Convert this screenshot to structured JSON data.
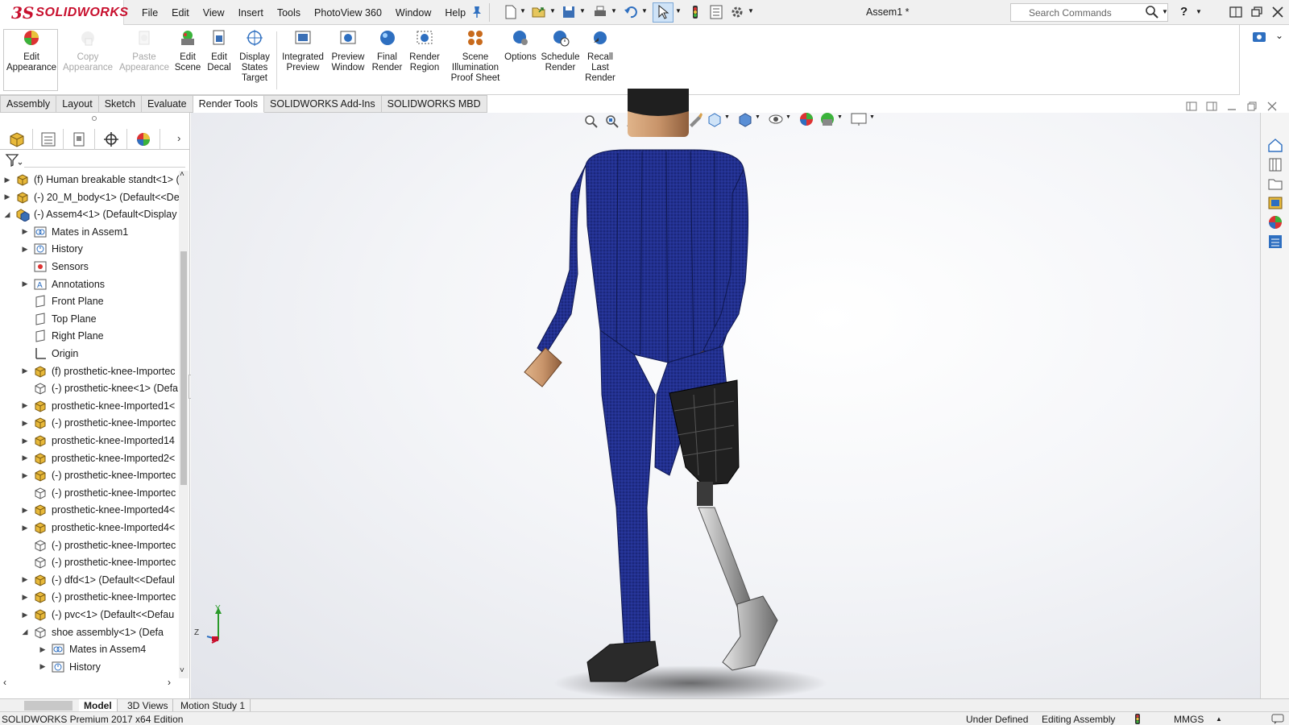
{
  "app": {
    "logo_ds": "3S",
    "logo_text": "SOLIDWORKS",
    "document_title": "Assem1 *",
    "search_placeholder": "Search Commands"
  },
  "menu": [
    "File",
    "Edit",
    "View",
    "Insert",
    "Tools",
    "PhotoView 360",
    "Window",
    "Help"
  ],
  "commands": [
    {
      "label": "Edit Appearance",
      "lines": [
        "Edit",
        "Appearance"
      ],
      "enabled": true,
      "icon": "edit-appearance-icon"
    },
    {
      "label": "Copy Appearance",
      "lines": [
        "Copy",
        "Appearance"
      ],
      "enabled": false,
      "icon": "copy-appearance-icon"
    },
    {
      "label": "Paste Appearance",
      "lines": [
        "Paste",
        "Appearance"
      ],
      "enabled": false,
      "icon": "paste-appearance-icon"
    },
    {
      "label": "Edit Scene",
      "lines": [
        "Edit",
        "Scene"
      ],
      "enabled": true,
      "icon": "edit-scene-icon"
    },
    {
      "label": "Edit Decal",
      "lines": [
        "Edit",
        "Decal"
      ],
      "enabled": true,
      "icon": "edit-decal-icon"
    },
    {
      "label": "Display States Target",
      "lines": [
        "Display",
        "States",
        "Target"
      ],
      "enabled": true,
      "icon": "display-states-icon"
    },
    {
      "label": "Integrated Preview",
      "lines": [
        "Integrated",
        "Preview"
      ],
      "enabled": true,
      "icon": "integrated-preview-icon"
    },
    {
      "label": "Preview Window",
      "lines": [
        "Preview",
        "Window"
      ],
      "enabled": true,
      "icon": "preview-window-icon"
    },
    {
      "label": "Final Render",
      "lines": [
        "Final",
        "Render"
      ],
      "enabled": true,
      "icon": "final-render-icon"
    },
    {
      "label": "Render Region",
      "lines": [
        "Render",
        "Region"
      ],
      "enabled": true,
      "icon": "render-region-icon"
    },
    {
      "label": "Scene Illumination Proof Sheet",
      "lines": [
        "Scene",
        "Illumination",
        "Proof Sheet"
      ],
      "enabled": true,
      "icon": "scene-illumination-icon"
    },
    {
      "label": "Options",
      "lines": [
        "Options"
      ],
      "enabled": true,
      "icon": "options-icon"
    },
    {
      "label": "Schedule Render",
      "lines": [
        "Schedule",
        "Render"
      ],
      "enabled": true,
      "icon": "schedule-render-icon"
    },
    {
      "label": "Recall Last Render",
      "lines": [
        "Recall",
        "Last",
        "Render"
      ],
      "enabled": true,
      "icon": "recall-render-icon"
    }
  ],
  "tabs": [
    "Assembly",
    "Layout",
    "Sketch",
    "Evaluate",
    "Render Tools",
    "SOLIDWORKS Add-Ins",
    "SOLIDWORKS MBD"
  ],
  "active_tab": "Render Tools",
  "tree": [
    {
      "text": "(f) Human breakable standt<1> (",
      "level": 0,
      "arrow": "right",
      "icon": "assembly"
    },
    {
      "text": "(-) 20_M_body<1> (Default<<De",
      "level": 0,
      "arrow": "right",
      "icon": "assembly"
    },
    {
      "text": "(-) Assem4<1> (Default<Display",
      "level": 0,
      "arrow": "down",
      "icon": "subassembly"
    },
    {
      "text": "Mates in Assem1",
      "level": 1,
      "arrow": "right",
      "icon": "mates"
    },
    {
      "text": "History",
      "level": 1,
      "arrow": "right",
      "icon": "history"
    },
    {
      "text": "Sensors",
      "level": 1,
      "arrow": "",
      "icon": "sensors"
    },
    {
      "text": "Annotations",
      "level": 1,
      "arrow": "right",
      "icon": "annotations"
    },
    {
      "text": "Front Plane",
      "level": 1,
      "arrow": "",
      "icon": "plane"
    },
    {
      "text": "Top Plane",
      "level": 1,
      "arrow": "",
      "icon": "plane"
    },
    {
      "text": "Right Plane",
      "level": 1,
      "arrow": "",
      "icon": "plane"
    },
    {
      "text": "Origin",
      "level": 1,
      "arrow": "",
      "icon": "origin"
    },
    {
      "text": "(f) prosthetic-knee-Importec",
      "level": 1,
      "arrow": "right",
      "icon": "part"
    },
    {
      "text": "(-) prosthetic-knee<1> (Defa",
      "level": 1,
      "arrow": "",
      "icon": "part-outline"
    },
    {
      "text": "prosthetic-knee-Imported1<",
      "level": 1,
      "arrow": "right",
      "icon": "part"
    },
    {
      "text": "(-) prosthetic-knee-Importec",
      "level": 1,
      "arrow": "right",
      "icon": "part"
    },
    {
      "text": "prosthetic-knee-Imported14",
      "level": 1,
      "arrow": "right",
      "icon": "part"
    },
    {
      "text": "prosthetic-knee-Imported2<",
      "level": 1,
      "arrow": "right",
      "icon": "part"
    },
    {
      "text": "(-) prosthetic-knee-Importec",
      "level": 1,
      "arrow": "right",
      "icon": "part"
    },
    {
      "text": "(-) prosthetic-knee-Importec",
      "level": 1,
      "arrow": "",
      "icon": "part-outline"
    },
    {
      "text": "prosthetic-knee-Imported4<",
      "level": 1,
      "arrow": "right",
      "icon": "part"
    },
    {
      "text": "prosthetic-knee-Imported4<",
      "level": 1,
      "arrow": "right",
      "icon": "part"
    },
    {
      "text": "(-) prosthetic-knee-Importec",
      "level": 1,
      "arrow": "",
      "icon": "part-outline"
    },
    {
      "text": "(-) prosthetic-knee-Importec",
      "level": 1,
      "arrow": "",
      "icon": "part-outline"
    },
    {
      "text": "(-) dfd<1> (Default<<Defaul",
      "level": 1,
      "arrow": "right",
      "icon": "part"
    },
    {
      "text": "(-) prosthetic-knee-Importec",
      "level": 1,
      "arrow": "right",
      "icon": "part"
    },
    {
      "text": "(-) pvc<1> (Default<<Defau",
      "level": 1,
      "arrow": "right",
      "icon": "part"
    },
    {
      "text": "shoe assembly<1> (Defa",
      "level": 1,
      "arrow": "down",
      "icon": "subassembly-outline"
    },
    {
      "text": "Mates in Assem4",
      "level": 2,
      "arrow": "right",
      "icon": "mates"
    },
    {
      "text": "History",
      "level": 2,
      "arrow": "right",
      "icon": "history"
    }
  ],
  "bottom_tabs": [
    "Model",
    "3D Views",
    "Motion Study 1"
  ],
  "active_bottom_tab": "Model",
  "status": {
    "edition": "SOLIDWORKS Premium 2017 x64 Edition",
    "definition": "Under Defined",
    "mode": "Editing Assembly",
    "units": "MMGS"
  },
  "triad": {
    "y_label": "Y",
    "z_label": "Z"
  },
  "colors": {
    "suit": "#1f2f8c",
    "skin": "#c8946a",
    "socket": "#222222",
    "pylon": "#b9b9b9",
    "brand": "#c8102e"
  }
}
